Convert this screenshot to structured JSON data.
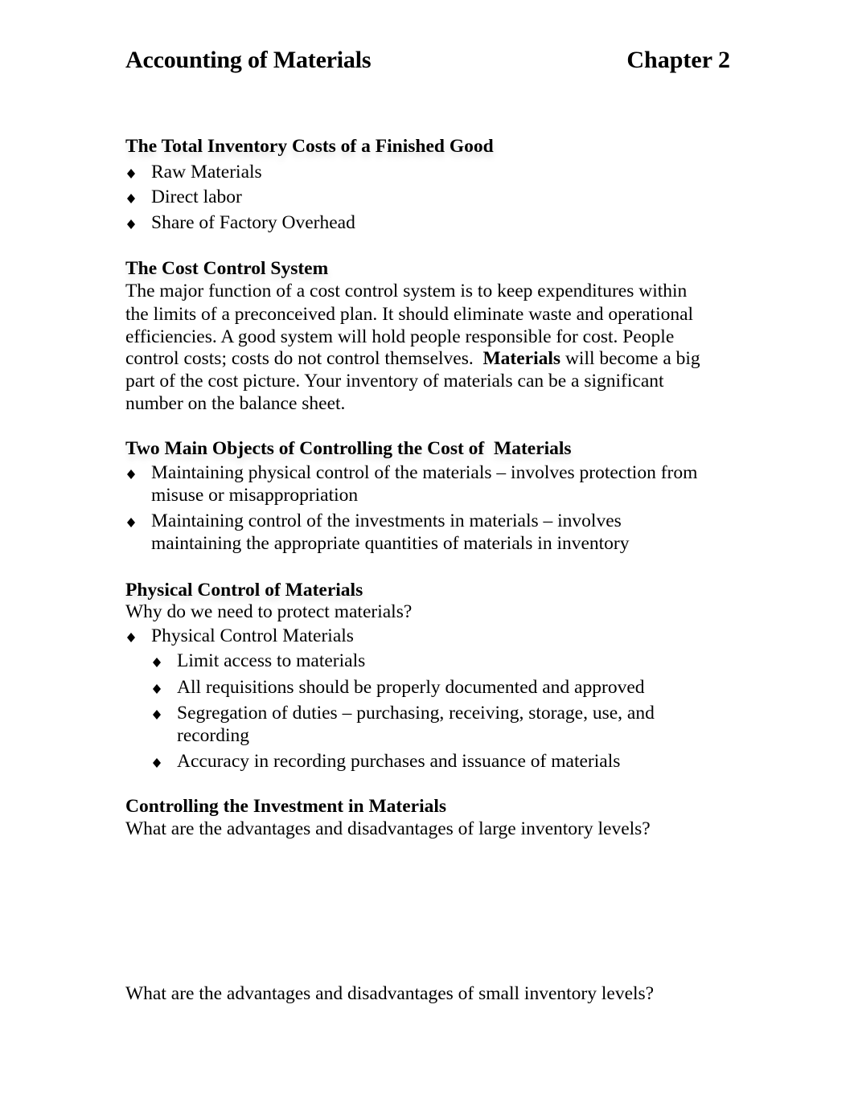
{
  "header": {
    "title": "Accounting of Materials",
    "chapter": "Chapter 2"
  },
  "sections": {
    "total_inventory": {
      "heading": "The Total Inventory Costs of a Finished Good",
      "items": [
        "Raw Materials",
        "Direct labor",
        "Share of Factory Overhead"
      ]
    },
    "cost_control": {
      "heading": "The Cost Control System",
      "lines": [
        "The major function of a cost control system is to keep expenditures within",
        "the limits of a preconceived plan.  It should eliminate waste and operational",
        "efficiencies.  A good system will hold people responsible for cost.  People",
        "control costs; costs do not control themselves.  ",
        "part of the cost picture.  Your inventory of materials can be a significant",
        "number on the balance sheet."
      ],
      "bold_word": "Materials",
      "after_bold": " will become a big"
    },
    "two_objects": {
      "heading": "Two Main Objects of Controlling the Cost of  Materials",
      "items": [
        [
          "Maintaining physical control of the materials – involves protection from",
          "misuse or misappropriation"
        ],
        [
          "Maintaining control of the investments in materials – involves",
          "maintaining the appropriate quantities of materials in inventory"
        ]
      ]
    },
    "physical_control": {
      "heading": "Physical Control of Materials",
      "question": "Why do we need to protect materials?",
      "item": "Physical Control Materials",
      "subitems": [
        [
          "Limit access to materials"
        ],
        [
          "All requisitions should be properly documented and approved"
        ],
        [
          "Segregation of duties – purchasing, receiving, storage, use, and",
          "recording"
        ],
        [
          "Accuracy in recording purchases and issuance of materials"
        ]
      ]
    },
    "investment": {
      "heading": "Controlling the Investment in Materials",
      "question_large": "What are the advantages and disadvantages of large inventory levels?",
      "question_small": "What are the advantages and disadvantages of small inventory levels?"
    }
  }
}
